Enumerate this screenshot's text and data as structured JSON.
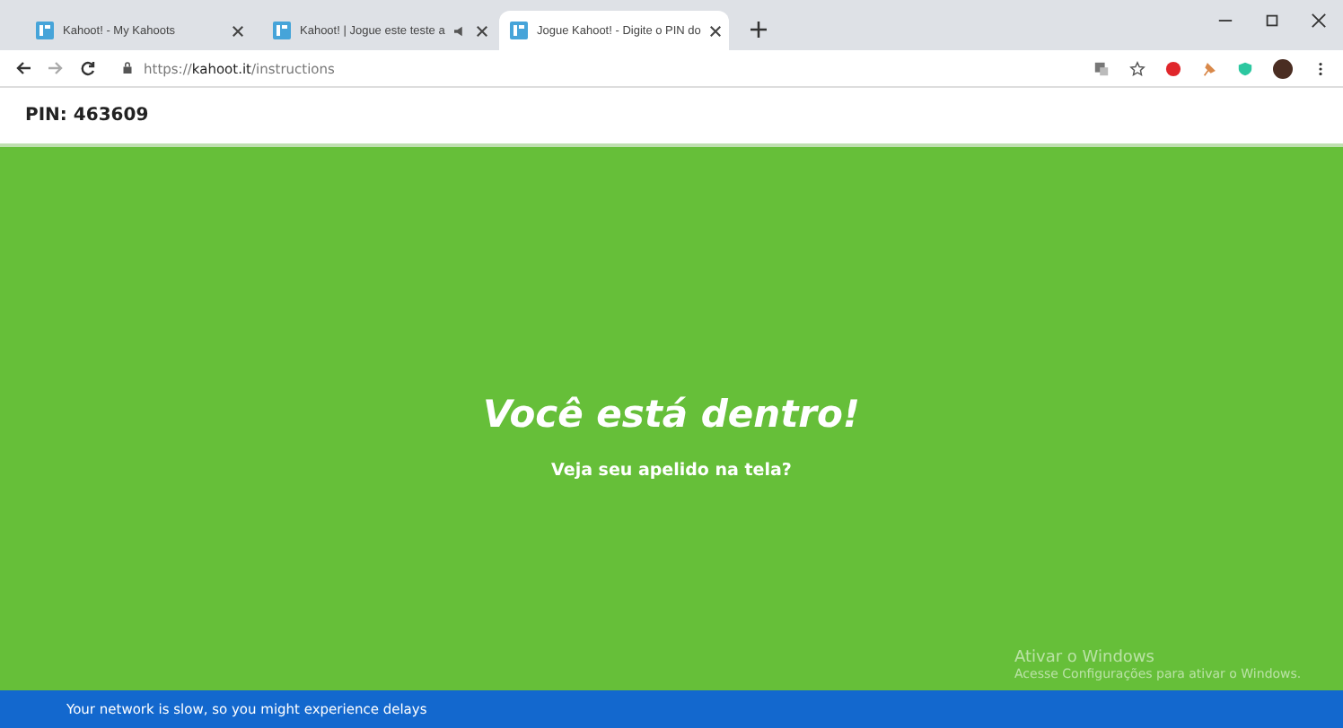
{
  "tabs": [
    {
      "title": "Kahoot! - My Kahoots",
      "selected": false,
      "audio": false
    },
    {
      "title": "Kahoot! | Jogue este teste a",
      "selected": false,
      "audio": true
    },
    {
      "title": "Jogue Kahoot! - Digite o PIN do",
      "selected": true,
      "audio": false
    }
  ],
  "address": {
    "secure": true,
    "host": "kahoot.it",
    "path": "/instructions",
    "scheme": "https://"
  },
  "pin": "PIN: 463609",
  "main": {
    "heading": "Você está dentro!",
    "subheading": "Veja seu apelido na tela?"
  },
  "windows_notice": {
    "title": "Ativar o Windows",
    "text": "Acesse Configurações para ativar o Windows."
  },
  "status_bar": "Your network is slow, so you might experience delays"
}
